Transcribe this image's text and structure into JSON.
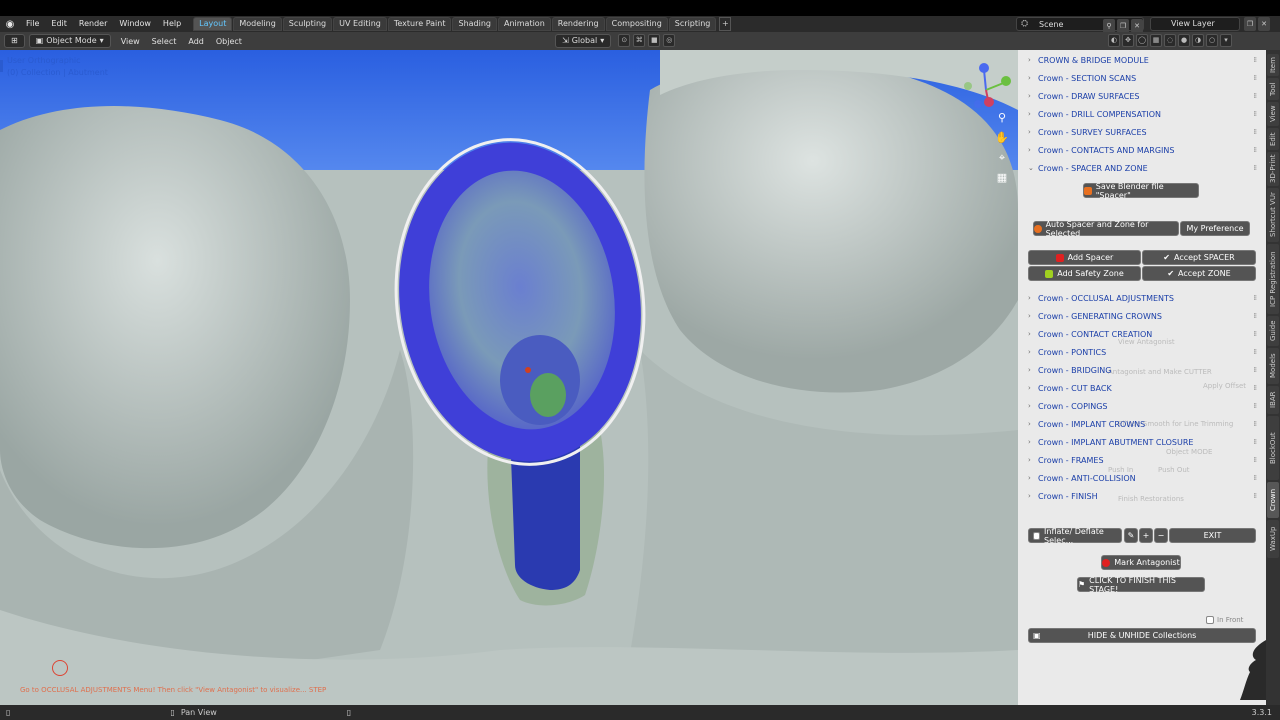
{
  "topbar": {
    "menus": [
      "File",
      "Edit",
      "Render",
      "Window",
      "Help"
    ],
    "workspaces": [
      "Layout",
      "Modeling",
      "Sculpting",
      "UV Editing",
      "Texture Paint",
      "Shading",
      "Animation",
      "Rendering",
      "Compositing",
      "Scripting"
    ],
    "active_workspace": "Layout",
    "add_label": "+",
    "scene": "Scene",
    "view_layer": "View Layer"
  },
  "header": {
    "mode": "Object Mode",
    "menus": [
      "View",
      "Select",
      "Add",
      "Object"
    ],
    "transform": "Global"
  },
  "viewport": {
    "view_name": "User Orthographic",
    "collection": "(0) Collection | Abutment",
    "hint_text": "Go to OCCLUSAL ADJUSTMENTS Menu! Then click \"View Antagonist\" to visualize... STEP",
    "gizmo_axes": [
      "X",
      "Y",
      "Z"
    ]
  },
  "panel": {
    "sections_top": [
      "CROWN & BRIDGE MODULE",
      "Crown - SECTION SCANS",
      "Crown - DRAW SURFACES",
      "Crown - DRILL COMPENSATION",
      "Crown - SURVEY SURFACES",
      "Crown - CONTACTS AND MARGINS",
      "Crown - SPACER AND ZONE"
    ],
    "save_spacer": "Save Blender file \"Spacer\"",
    "auto_spacer": "Auto Spacer and Zone for Selected",
    "my_preference": "My Preference",
    "add_spacer": "Add Spacer",
    "accept_spacer": "Accept SPACER",
    "add_safety_zone": "Add Safety Zone",
    "accept_zone": "Accept ZONE",
    "sections_bottom": [
      "Crown - OCCLUSAL ADJUSTMENTS",
      "Crown - GENERATING CROWNS",
      "Crown - CONTACT CREATION",
      "Crown - PONTICS",
      "Crown - BRIDGING",
      "Crown - CUT BACK",
      "Crown - COPINGS",
      "Crown - IMPLANT CROWNS",
      "Crown - IMPLANT  ABUTMENT CLOSURE",
      "Crown - FRAMES",
      "Crown - ANTI-COLLISION",
      "Crown - FINISH"
    ],
    "ghost_texts": [
      "View Antagonist",
      "Antagonist and Make CUTTER",
      "Apply Offset",
      "Ellipse Smooth for Line Trimming",
      "Object MODE",
      "Push In",
      "Push Out",
      "Finish Restorations"
    ],
    "inflate": "Inflate/ Deflate Selec...",
    "plus": "+",
    "minus": "−",
    "exit": "EXIT",
    "mark_antagonist": "Mark Antagonist",
    "finish_stage": "CLICK TO FINISH THIS STAGE!",
    "in_front": "In Front",
    "hide_unhide": "HIDE & UNHIDE Collections"
  },
  "side_tabs": [
    "Item",
    "Tool",
    "View",
    "Edit",
    "3D-Print",
    "Shortcut VUr",
    "ICP Registration",
    "Guide",
    "Models",
    "IBAR",
    "BlockOut",
    "Crown",
    "WaxUp"
  ],
  "active_side_tab": "Crown",
  "statusbar": {
    "left_action": "Pan View",
    "version": "3.3.1"
  },
  "colors": {
    "accent_blue": "#64c8ff",
    "section_text": "#1a3ea8",
    "margin_blue": "#4040d8",
    "tooth_gray": "#b9c3c0",
    "red_dot": "#e02020",
    "orange_dot": "#e87020",
    "green_dot": "#a0d020"
  }
}
